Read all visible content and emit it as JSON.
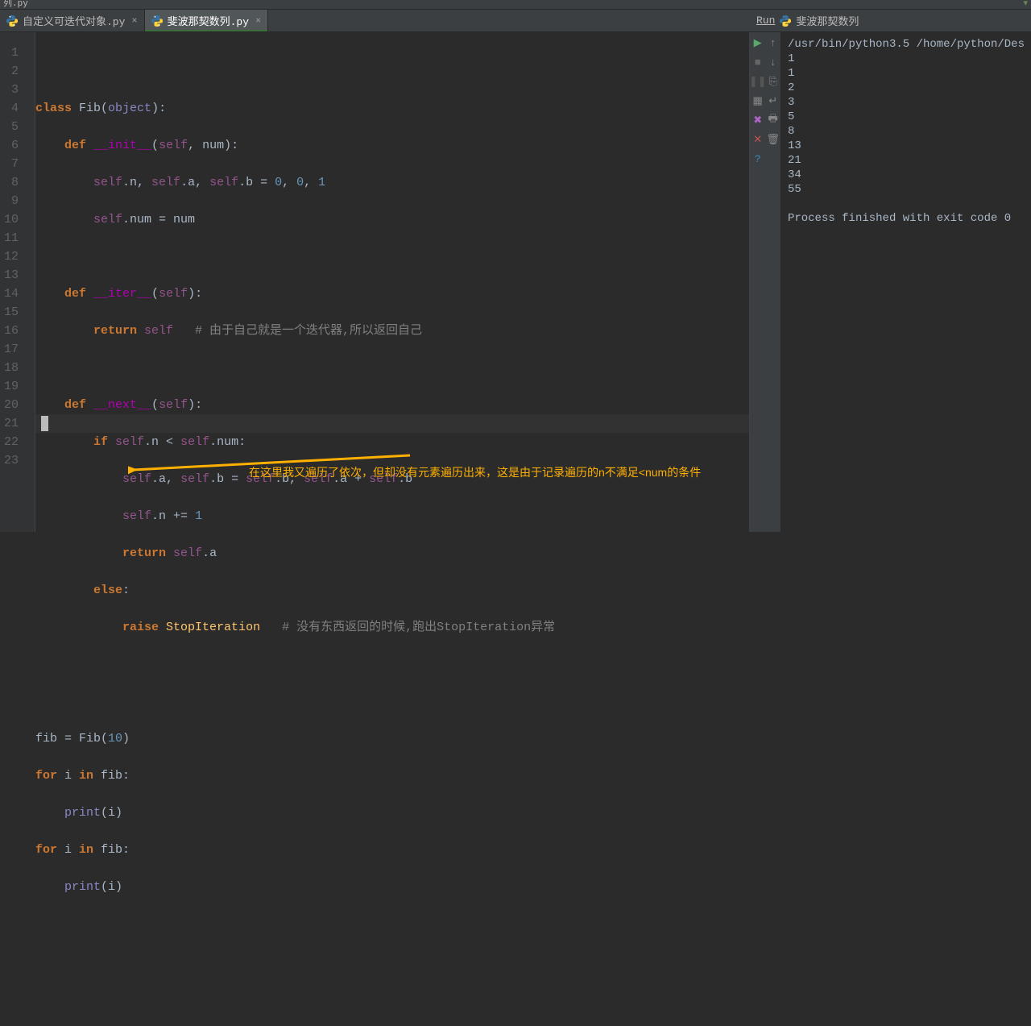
{
  "topleft": "列.py",
  "tabs": [
    {
      "label": "自定义可迭代对象.py"
    },
    {
      "label": "斐波那契数列.py"
    }
  ],
  "run_label": "Run",
  "run_title": "斐波那契数列",
  "gutter": [
    "1",
    "2",
    "3",
    "4",
    "5",
    "6",
    "7",
    "8",
    "9",
    "10",
    "11",
    "12",
    "13",
    "14",
    "15",
    "16",
    "17",
    "18",
    "19",
    "20",
    "21",
    "22",
    "23"
  ],
  "code": {
    "l1_kw": "class ",
    "l1_cls": "Fib",
    "l1_p1": "(",
    "l1_obj": "object",
    "l1_p2": "):",
    "l2_kw": "def ",
    "l2_fn": "__init__",
    "l2_p": "(",
    "l2_self": "self",
    "l2_c": ", num):",
    "l3_self1": "self",
    "l3_p1": ".n, ",
    "l3_self2": "self",
    "l3_p2": ".a, ",
    "l3_self3": "self",
    "l3_p3": ".b = ",
    "l3_n1": "0",
    "l3_c1": ", ",
    "l3_n2": "0",
    "l3_c2": ", ",
    "l3_n3": "1",
    "l4_self": "self",
    "l4_p": ".num = num",
    "l6_kw": "def ",
    "l6_fn": "__iter__",
    "l6_p": "(",
    "l6_self": "self",
    "l6_p2": "):",
    "l7_kw": "return ",
    "l7_self": "self",
    "l7_cmt": "   # 由于自己就是一个迭代器,所以返回自己",
    "l9_kw": "def ",
    "l9_fn": "__next__",
    "l9_p": "(",
    "l9_self": "self",
    "l9_p2": "):",
    "l10_kw": "if ",
    "l10_self1": "self",
    "l10_p1": ".n < ",
    "l10_self2": "self",
    "l10_p2": ".num:",
    "l11_self1": "self",
    "l11_p1": ".a, ",
    "l11_self2": "self",
    "l11_p2": ".b = ",
    "l11_self3": "self",
    "l11_p3": ".b, ",
    "l11_self4": "self",
    "l11_p4": ".a + ",
    "l11_self5": "self",
    "l11_p5": ".b",
    "l12_self": "self",
    "l12_p": ".n += ",
    "l12_n": "1",
    "l13_kw": "return ",
    "l13_self": "self",
    "l13_p": ".a",
    "l14_kw": "else",
    "l14_c": ":",
    "l15_kw": "raise ",
    "l15_ex": "StopIteration",
    "l15_cmt": "   # 没有东西返回的时候,跑出StopIteration异常",
    "l18_a": "fib = Fib(",
    "l18_n": "10",
    "l18_b": ")",
    "l19_kw": "for ",
    "l19_a": "i ",
    "l19_kw2": "in ",
    "l19_b": "fib:",
    "l20_a": "print",
    "l20_b": "(i)",
    "l21_kw": "for ",
    "l21_a": "i ",
    "l21_kw2": "in ",
    "l21_b": "fib:",
    "l22_a": "print",
    "l22_b": "(i)"
  },
  "console": "/usr/bin/python3.5 /home/python/Des\n1\n1\n2\n3\n5\n8\n13\n21\n34\n55\n\nProcess finished with exit code 0",
  "annotation": "在这里我又遍历了依次，但却没有元素遍历出来，这是由于记录遍历的n不满足<num的条件"
}
